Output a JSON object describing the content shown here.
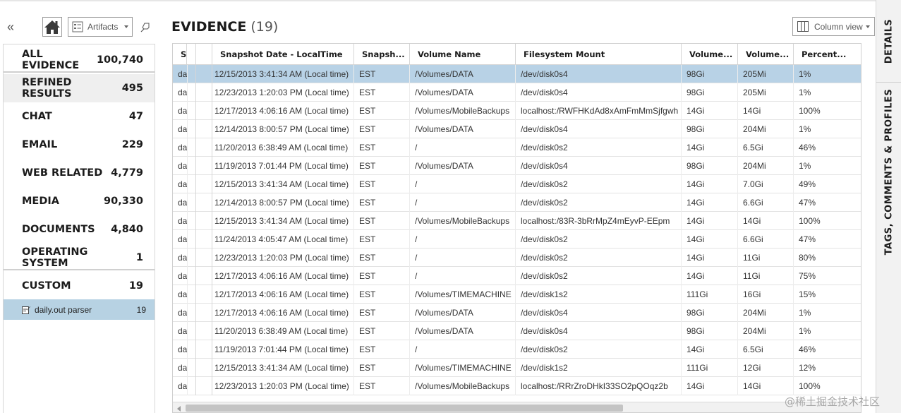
{
  "toolbar": {
    "collapse_icon": "«",
    "artifacts_label": "Artifacts"
  },
  "sidebar": {
    "categories": [
      {
        "label": "ALL EVIDENCE",
        "count": "100,740"
      },
      {
        "label": "REFINED RESULTS",
        "count": "495"
      },
      {
        "label": "CHAT",
        "count": "47"
      },
      {
        "label": "EMAIL",
        "count": "229"
      },
      {
        "label": "WEB RELATED",
        "count": "4,779"
      },
      {
        "label": "MEDIA",
        "count": "90,330"
      },
      {
        "label": "DOCUMENTS",
        "count": "4,840"
      },
      {
        "label": "OPERATING SYSTEM",
        "count": "1"
      },
      {
        "label": "CUSTOM",
        "count": "19"
      }
    ],
    "subitem": {
      "label": "daily.out parser",
      "count": "19"
    }
  },
  "main": {
    "title": "EVIDENCE",
    "count": "(19)",
    "column_view_label": "Column view"
  },
  "table": {
    "columns": [
      "Snapshot Date - LocalTime",
      "Snapsh...",
      "Volume Name",
      "Filesystem Mount",
      "Volume...",
      "Volume...",
      "Percent...",
      "S"
    ],
    "rows": [
      [
        "12/15/2013 3:41:34 AM (Local time)",
        "EST",
        "/Volumes/DATA",
        "/dev/disk0s4",
        "98Gi",
        "205Mi",
        "1%",
        "da"
      ],
      [
        "12/23/2013 1:20:03 PM (Local time)",
        "EST",
        "/Volumes/DATA",
        "/dev/disk0s4",
        "98Gi",
        "205Mi",
        "1%",
        "da"
      ],
      [
        "12/17/2013 4:06:16 AM (Local time)",
        "EST",
        "/Volumes/MobileBackups",
        "localhost:/RWFHKdAd8xAmFmMmSjfgwh",
        "14Gi",
        "14Gi",
        "100%",
        "da"
      ],
      [
        "12/14/2013 8:00:57 PM (Local time)",
        "EST",
        "/Volumes/DATA",
        "/dev/disk0s4",
        "98Gi",
        "204Mi",
        "1%",
        "da"
      ],
      [
        "11/20/2013 6:38:49 AM (Local time)",
        "EST",
        "/",
        "/dev/disk0s2",
        "14Gi",
        "6.5Gi",
        "46%",
        "da"
      ],
      [
        "11/19/2013 7:01:44 PM (Local time)",
        "EST",
        "/Volumes/DATA",
        "/dev/disk0s4",
        "98Gi",
        "204Mi",
        "1%",
        "da"
      ],
      [
        "12/15/2013 3:41:34 AM (Local time)",
        "EST",
        "/",
        "/dev/disk0s2",
        "14Gi",
        "7.0Gi",
        "49%",
        "da"
      ],
      [
        "12/14/2013 8:00:57 PM (Local time)",
        "EST",
        "/",
        "/dev/disk0s2",
        "14Gi",
        "6.6Gi",
        "47%",
        "da"
      ],
      [
        "12/15/2013 3:41:34 AM (Local time)",
        "EST",
        "/Volumes/MobileBackups",
        "localhost:/83R-3bRrMpZ4mEyvP-EEpm",
        "14Gi",
        "14Gi",
        "100%",
        "da"
      ],
      [
        "11/24/2013 4:05:47 AM (Local time)",
        "EST",
        "/",
        "/dev/disk0s2",
        "14Gi",
        "6.6Gi",
        "47%",
        "da"
      ],
      [
        "12/23/2013 1:20:03 PM (Local time)",
        "EST",
        "/",
        "/dev/disk0s2",
        "14Gi",
        "11Gi",
        "80%",
        "da"
      ],
      [
        "12/17/2013 4:06:16 AM (Local time)",
        "EST",
        "/",
        "/dev/disk0s2",
        "14Gi",
        "11Gi",
        "75%",
        "da"
      ],
      [
        "12/17/2013 4:06:16 AM (Local time)",
        "EST",
        "/Volumes/TIMEMACHINE",
        "/dev/disk1s2",
        "111Gi",
        "16Gi",
        "15%",
        "da"
      ],
      [
        "12/17/2013 4:06:16 AM (Local time)",
        "EST",
        "/Volumes/DATA",
        "/dev/disk0s4",
        "98Gi",
        "204Mi",
        "1%",
        "da"
      ],
      [
        "11/20/2013 6:38:49 AM (Local time)",
        "EST",
        "/Volumes/DATA",
        "/dev/disk0s4",
        "98Gi",
        "204Mi",
        "1%",
        "da"
      ],
      [
        "11/19/2013 7:01:44 PM (Local time)",
        "EST",
        "/",
        "/dev/disk0s2",
        "14Gi",
        "6.5Gi",
        "46%",
        "da"
      ],
      [
        "12/15/2013 3:41:34 AM (Local time)",
        "EST",
        "/Volumes/TIMEMACHINE",
        "/dev/disk1s2",
        "111Gi",
        "12Gi",
        "12%",
        "da"
      ],
      [
        "12/23/2013 1:20:03 PM (Local time)",
        "EST",
        "/Volumes/MobileBackups",
        "localhost:/RRrZroDHkI33SO2pQOqz2b",
        "14Gi",
        "14Gi",
        "100%",
        "da"
      ]
    ]
  },
  "right_tabs": [
    "DETAILS",
    "TAGS, COMMENTS & PROFILES"
  ],
  "watermark": "@稀土掘金技术社区",
  "colors": {
    "selected_row": "#b8d2e6",
    "selected_subitem": "#b7d2e3",
    "selected_category": "#efefef"
  }
}
